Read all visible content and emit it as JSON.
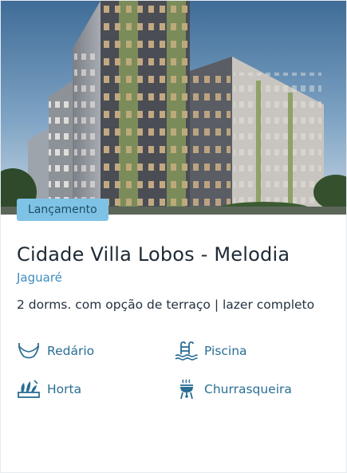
{
  "card": {
    "badge": "Lançamento",
    "title": "Cidade Villa Lobos - Melodia",
    "location": "Jaguaré",
    "description": "2 dorms. com opção de terraço | lazer completo"
  },
  "amenities": [
    {
      "label": "Redário",
      "icon": "hammock-icon"
    },
    {
      "label": "Piscina",
      "icon": "pool-icon"
    },
    {
      "label": "Horta",
      "icon": "garden-icon"
    },
    {
      "label": "Churrasqueira",
      "icon": "grill-icon"
    }
  ],
  "colors": {
    "badge_bg": "#7ec3e6",
    "location": "#3c8cbf",
    "amenity": "#2a6e94",
    "title": "#1e2a35"
  }
}
